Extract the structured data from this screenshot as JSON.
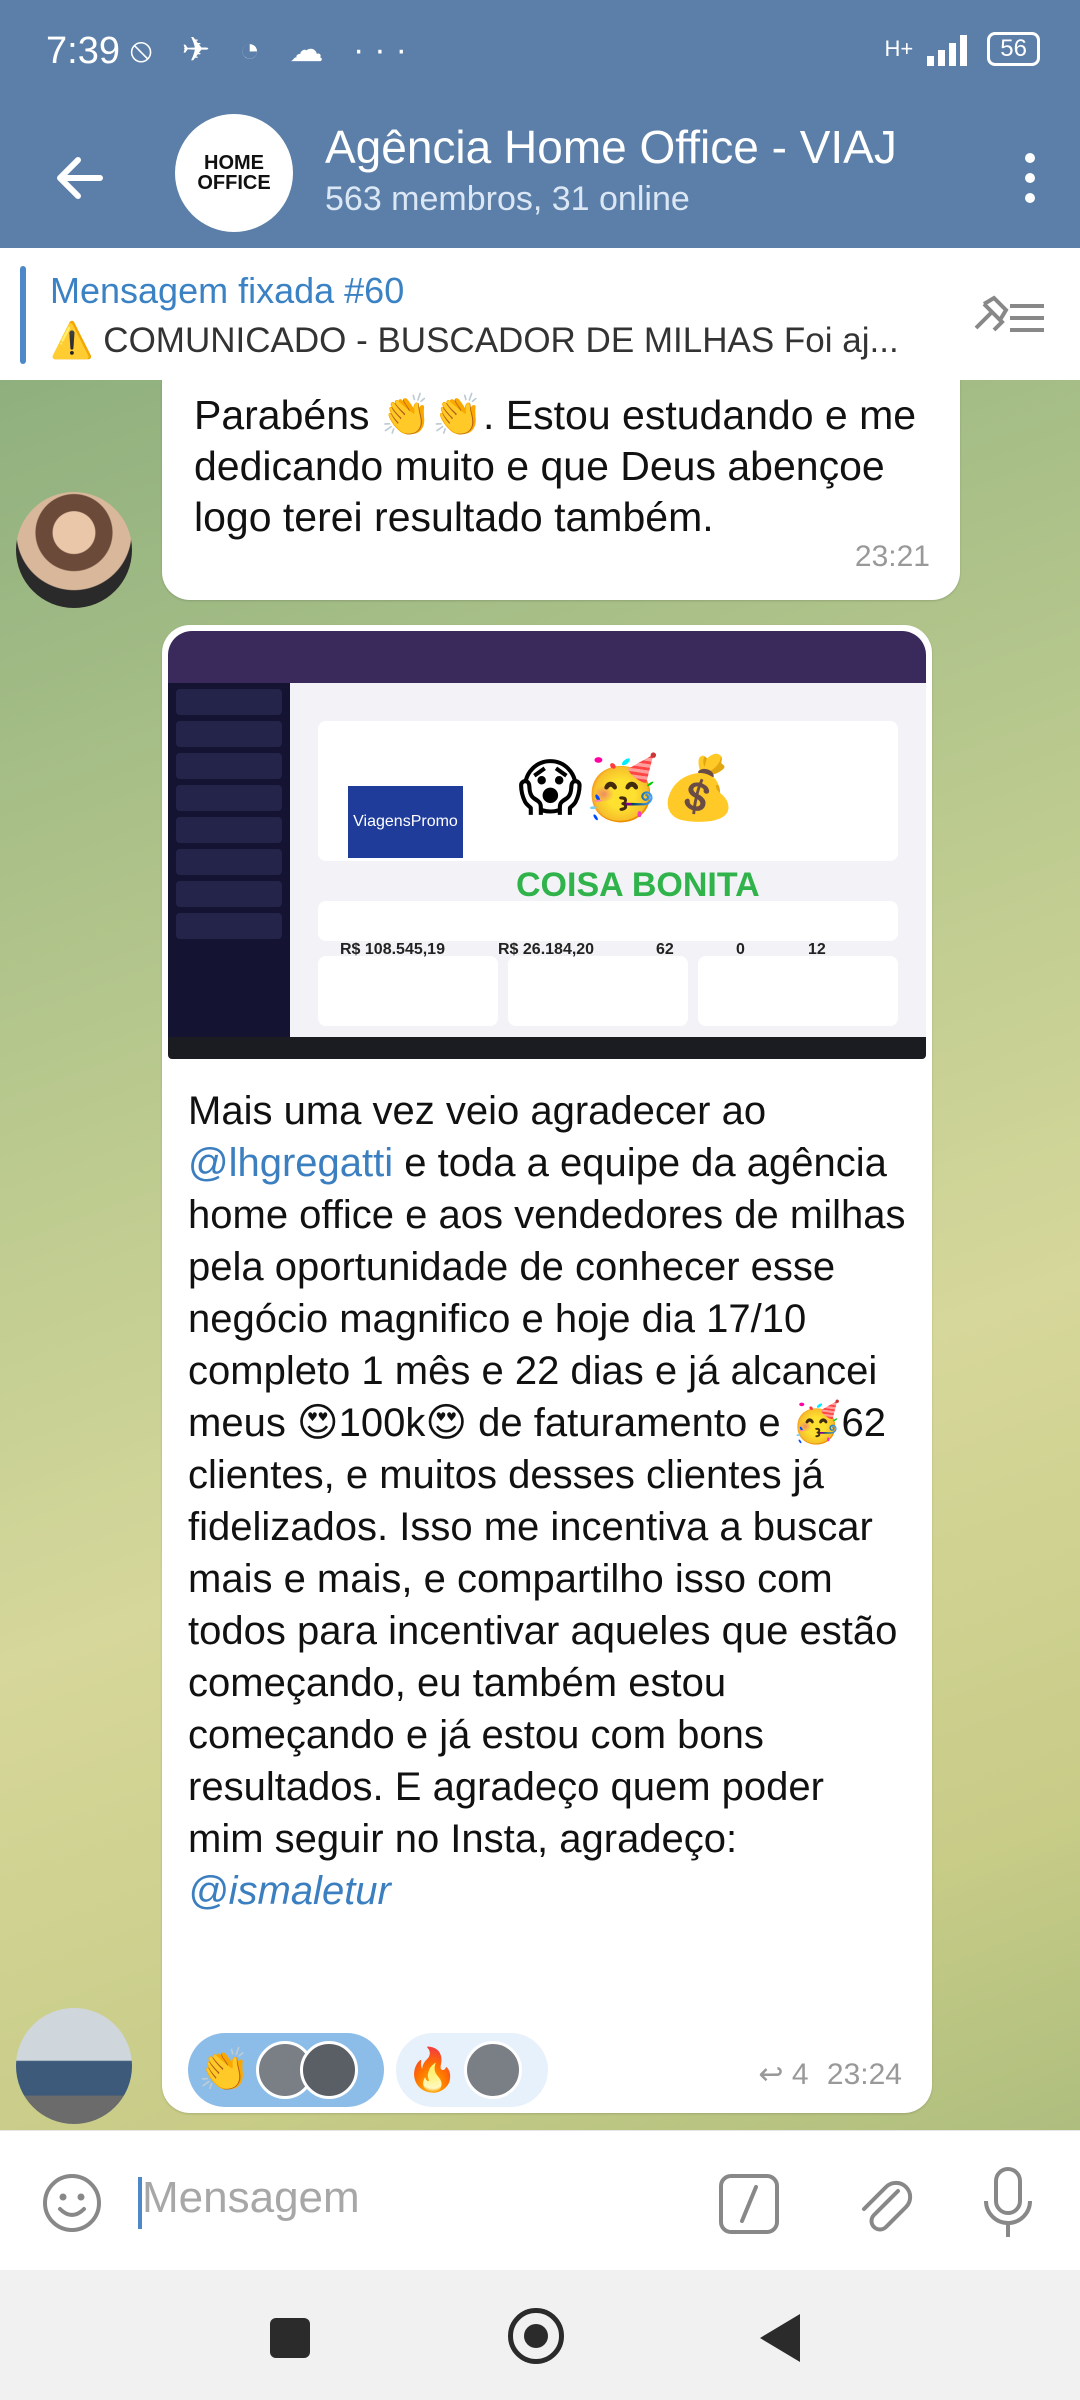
{
  "status": {
    "time": "7:39",
    "icons": "⦸ ✈ ◔ ☁ ···",
    "network": "H+",
    "battery": "56"
  },
  "header": {
    "title": "Agência Home Office - VIAJ",
    "subtitle": "563 membros, 31 online",
    "logo_text": "HOME OFFICE"
  },
  "pinned": {
    "title": "Mensagem fixada #60",
    "text": "⚠️ COMUNICADO - BUSCADOR DE MILHAS  Foi aj..."
  },
  "messages": [
    {
      "text": "Parabéns 👏👏. Estou  estudando e me dedicando muito e que Deus abençoe logo terei resultado também.",
      "time": "23:21"
    },
    {
      "image": {
        "brand": "ViagensPromo",
        "overlay": "COISA BONITA",
        "emojis": "😱🥳💰",
        "metrics": [
          "R$ 108.545,19",
          "R$ 26.184,20",
          "62",
          "0",
          "12"
        ]
      },
      "text_before": "Mais uma vez veio agradecer ao ",
      "mention1": "@lhgregatti",
      "text_middle": " e toda a equipe da agência home office e aos vendedores de milhas pela oportunidade de conhecer esse negócio magnifico e hoje dia 17/10 completo 1 mês e 22 dias e já alcancei meus 😍100k😍 de faturamento e 🥳62 clientes, e muitos desses clientes já fidelizados. Isso me incentiva a buscar mais e mais, e compartilho isso com todos para incentivar aqueles que estão começando, eu também estou começando e já estou com bons resultados. E agradeço quem poder mim seguir no Insta, agradeço: ",
      "mention2": "@ismaletur",
      "reaction1": "👏",
      "reaction2": "🔥",
      "replies": "↩ 4",
      "time": "23:24"
    }
  ],
  "input": {
    "placeholder": "Mensagem"
  }
}
